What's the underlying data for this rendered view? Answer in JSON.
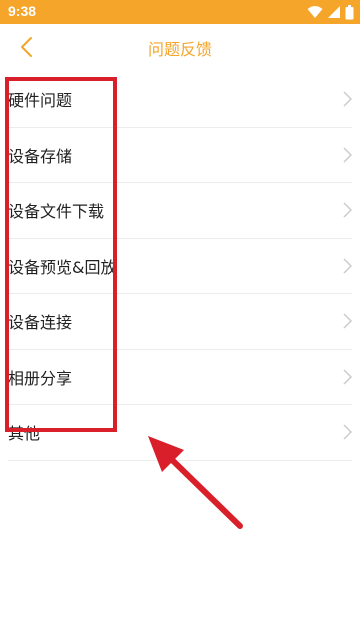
{
  "status_bar": {
    "time": "9:38",
    "icons": [
      "wifi-icon",
      "signal-icon",
      "battery-icon"
    ],
    "background": "#f5a52a"
  },
  "header": {
    "title": "问题反馈",
    "back_icon": "chevron-left-icon",
    "accent": "#f5a52a"
  },
  "list": {
    "items": [
      {
        "label": "硬件问题"
      },
      {
        "label": "设备存储"
      },
      {
        "label": "设备文件下载"
      },
      {
        "label": "设备预览&回放"
      },
      {
        "label": "设备连接"
      },
      {
        "label": "相册分享"
      },
      {
        "label": "其他"
      }
    ],
    "chevron_icon": "chevron-right-icon"
  },
  "annotation": {
    "box_color": "#d81f2a",
    "arrow_color": "#d81f2a"
  }
}
